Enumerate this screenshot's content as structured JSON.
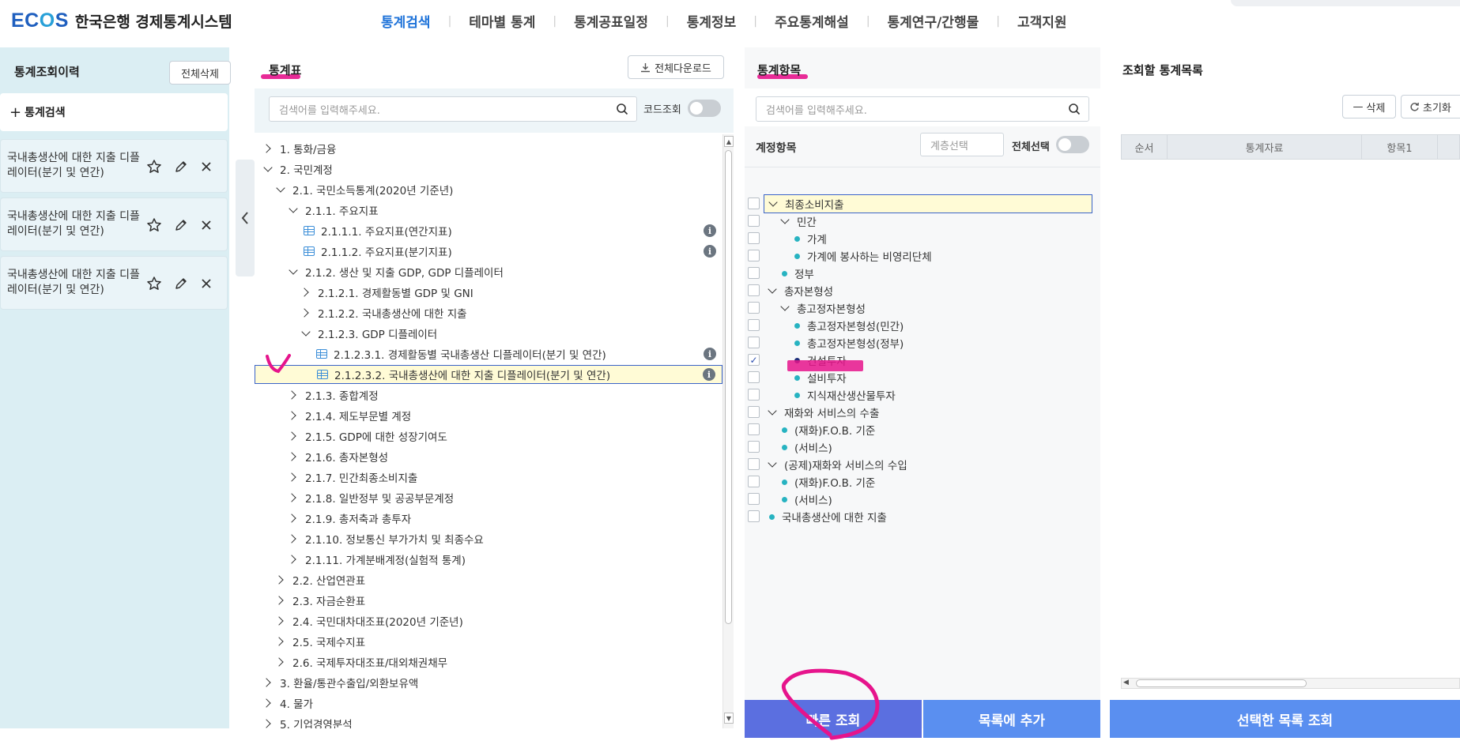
{
  "header": {
    "logo_text": "ECOS",
    "site_title": "한국은행 경제통계시스템",
    "nav": [
      "통계검색",
      "테마별 통계",
      "통계공표일정",
      "통계정보",
      "주요통계해설",
      "통계연구/간행물",
      "고객지원"
    ],
    "nav_active": "통계검색"
  },
  "history": {
    "title": "통계조회이력",
    "clear_all": "전체삭제",
    "add_label": "통계검색",
    "items": [
      {
        "label": "국내총생산에 대한 지출 디플레이터(분기 및 연간)"
      },
      {
        "label": "국내총생산에 대한 지출 디플레이터(분기 및 연간)"
      },
      {
        "label": "국내총생산에 대한 지출 디플레이터(분기 및 연간)"
      }
    ]
  },
  "stats_table": {
    "title": "통계표",
    "download_all": "전체다운로드",
    "search_placeholder": "검색어를 입력해주세요.",
    "code_lookup": "코드조회",
    "tree": [
      {
        "label": "1. 통화/금융",
        "level": 0,
        "type": "folder",
        "expanded": false
      },
      {
        "label": "2. 국민계정",
        "level": 0,
        "type": "folder",
        "expanded": true
      },
      {
        "label": "2.1. 국민소득통계(2020년 기준년)",
        "level": 1,
        "type": "folder",
        "expanded": true
      },
      {
        "label": "2.1.1. 주요지표",
        "level": 2,
        "type": "folder",
        "expanded": true
      },
      {
        "label": "2.1.1.1. 주요지표(연간지표)",
        "level": 3,
        "type": "table",
        "info": true
      },
      {
        "label": "2.1.1.2. 주요지표(분기지표)",
        "level": 3,
        "type": "table",
        "info": true
      },
      {
        "label": "2.1.2. 생산 및 지출 GDP, GDP 디플레이터",
        "level": 2,
        "type": "folder",
        "expanded": true
      },
      {
        "label": "2.1.2.1. 경제활동별 GDP 및 GNI",
        "level": 3,
        "type": "folder",
        "expanded": false
      },
      {
        "label": "2.1.2.2. 국내총생산에 대한 지출",
        "level": 3,
        "type": "folder",
        "expanded": false
      },
      {
        "label": "2.1.2.3. GDP 디플레이터",
        "level": 3,
        "type": "folder",
        "expanded": true
      },
      {
        "label": "2.1.2.3.1. 경제활동별 국내총생산 디플레이터(분기 및 연간)",
        "level": 4,
        "type": "table",
        "info": true
      },
      {
        "label": "2.1.2.3.2. 국내총생산에 대한 지출 디플레이터(분기 및 연간)",
        "level": 4,
        "type": "table",
        "info": true,
        "selected": true
      },
      {
        "label": "2.1.3. 종합계정",
        "level": 2,
        "type": "folder",
        "expanded": false
      },
      {
        "label": "2.1.4. 제도부문별 계정",
        "level": 2,
        "type": "folder",
        "expanded": false
      },
      {
        "label": "2.1.5. GDP에 대한 성장기여도",
        "level": 2,
        "type": "folder",
        "expanded": false
      },
      {
        "label": "2.1.6. 총자본형성",
        "level": 2,
        "type": "folder",
        "expanded": false
      },
      {
        "label": "2.1.7. 민간최종소비지출",
        "level": 2,
        "type": "folder",
        "expanded": false
      },
      {
        "label": "2.1.8. 일반정부 및 공공부문계정",
        "level": 2,
        "type": "folder",
        "expanded": false
      },
      {
        "label": "2.1.9. 총저축과 총투자",
        "level": 2,
        "type": "folder",
        "expanded": false
      },
      {
        "label": "2.1.10. 정보통신 부가가치 및 최종수요",
        "level": 2,
        "type": "folder",
        "expanded": false
      },
      {
        "label": "2.1.11. 가계분배계정(실험적 통계)",
        "level": 2,
        "type": "folder",
        "expanded": false
      },
      {
        "label": "2.2. 산업연관표",
        "level": 1,
        "type": "folder",
        "expanded": false
      },
      {
        "label": "2.3. 자금순환표",
        "level": 1,
        "type": "folder",
        "expanded": false
      },
      {
        "label": "2.4. 국민대차대조표(2020년 기준년)",
        "level": 1,
        "type": "folder",
        "expanded": false
      },
      {
        "label": "2.5. 국제수지표",
        "level": 1,
        "type": "folder",
        "expanded": false
      },
      {
        "label": "2.6. 국제투자대조표/대외채권채무",
        "level": 1,
        "type": "folder",
        "expanded": false
      },
      {
        "label": "3. 환율/통관수출입/외환보유액",
        "level": 0,
        "type": "folder",
        "expanded": false
      },
      {
        "label": "4. 물가",
        "level": 0,
        "type": "folder",
        "expanded": false
      },
      {
        "label": "5. 기업경영분석",
        "level": 0,
        "type": "folder",
        "expanded": false
      }
    ]
  },
  "stat_items": {
    "title": "통계항목",
    "search_placeholder": "검색어를 입력해주세요.",
    "account_label": "계정항목",
    "level_select_placeholder": "계층선택",
    "select_all": "전체선택",
    "items": [
      {
        "label": "최종소비지출",
        "level": 0,
        "kind": "folder",
        "checked": false,
        "selected": true
      },
      {
        "label": "민간",
        "level": 1,
        "kind": "folder",
        "checked": false
      },
      {
        "label": "가계",
        "level": 2,
        "kind": "leaf",
        "checked": false
      },
      {
        "label": "가계에 봉사하는 비영리단체",
        "level": 2,
        "kind": "leaf",
        "checked": false
      },
      {
        "label": "정부",
        "level": 1,
        "kind": "leaf",
        "checked": false
      },
      {
        "label": "총자본형성",
        "level": 0,
        "kind": "folder",
        "checked": false
      },
      {
        "label": "총고정자본형성",
        "level": 1,
        "kind": "folder",
        "checked": false
      },
      {
        "label": "총고정자본형성(민간)",
        "level": 2,
        "kind": "leaf",
        "checked": false
      },
      {
        "label": "총고정자본형성(정부)",
        "level": 2,
        "kind": "leaf",
        "checked": false
      },
      {
        "label": "건설투자",
        "level": 2,
        "kind": "leaf",
        "checked": true
      },
      {
        "label": "설비투자",
        "level": 2,
        "kind": "leaf",
        "checked": false
      },
      {
        "label": "지식재산생산물투자",
        "level": 2,
        "kind": "leaf",
        "checked": false
      },
      {
        "label": "재화와 서비스의 수출",
        "level": 0,
        "kind": "folder",
        "checked": false
      },
      {
        "label": "(재화)F.O.B. 기준",
        "level": 1,
        "kind": "leaf",
        "checked": false
      },
      {
        "label": "(서비스)",
        "level": 1,
        "kind": "leaf",
        "checked": false
      },
      {
        "label": "(공제)재화와 서비스의 수입",
        "level": 0,
        "kind": "folder",
        "checked": false
      },
      {
        "label": "(재화)F.O.B. 기준",
        "level": 1,
        "kind": "leaf",
        "checked": false
      },
      {
        "label": "(서비스)",
        "level": 1,
        "kind": "leaf",
        "checked": false
      },
      {
        "label": "국내총생산에 대한 지출",
        "level": 0,
        "kind": "leaf",
        "checked": false
      }
    ],
    "quick_query": "빠른 조회",
    "add_to_list": "목록에 추가"
  },
  "query_list": {
    "title": "조회할 통계목록",
    "delete": "삭제",
    "reset": "초기화",
    "columns": [
      "순서",
      "통계자료",
      "항목1"
    ],
    "query_selected": "선택한 목록 조회"
  },
  "colors": {
    "brand": "#1f5fbf",
    "active_nav": "#1f73d9",
    "quick_btn": "#5b6fe0",
    "add_btn": "#5a8ff0",
    "annotation": "#e6148c"
  }
}
